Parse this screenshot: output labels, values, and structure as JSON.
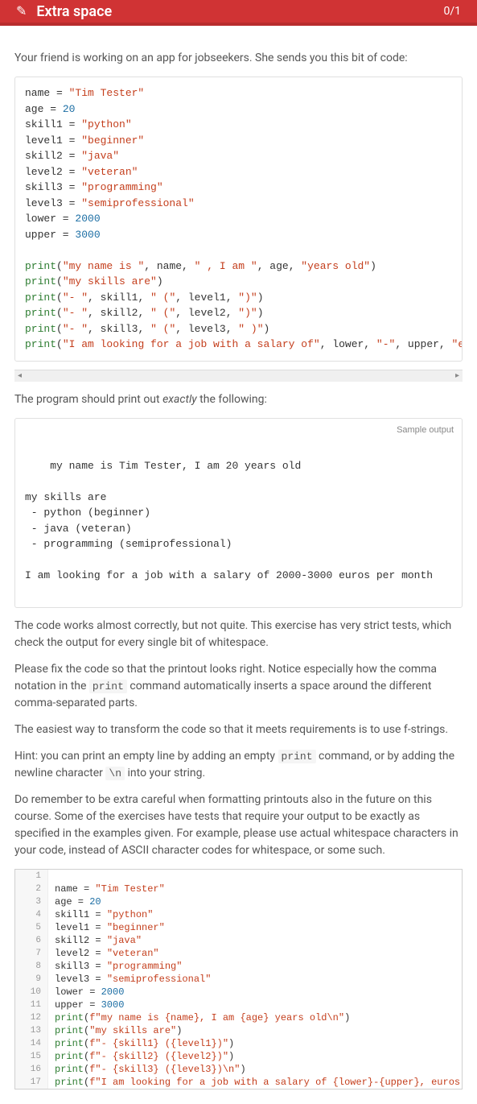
{
  "header": {
    "title": "Extra space",
    "score": "0/1"
  },
  "intro": "Your friend is working on an app for jobseekers. She sends you this bit of code:",
  "code1": [
    [
      [
        "kw",
        "name = "
      ],
      [
        "str",
        "\"Tim Tester\""
      ]
    ],
    [
      [
        "kw",
        "age = "
      ],
      [
        "num",
        "20"
      ]
    ],
    [
      [
        "kw",
        "skill1 = "
      ],
      [
        "str",
        "\"python\""
      ]
    ],
    [
      [
        "kw",
        "level1 = "
      ],
      [
        "str",
        "\"beginner\""
      ]
    ],
    [
      [
        "kw",
        "skill2 = "
      ],
      [
        "str",
        "\"java\""
      ]
    ],
    [
      [
        "kw",
        "level2 = "
      ],
      [
        "str",
        "\"veteran\""
      ]
    ],
    [
      [
        "kw",
        "skill3 = "
      ],
      [
        "str",
        "\"programming\""
      ]
    ],
    [
      [
        "kw",
        "level3 = "
      ],
      [
        "str",
        "\"semiprofessional\""
      ]
    ],
    [
      [
        "kw",
        "lower = "
      ],
      [
        "num",
        "2000"
      ]
    ],
    [
      [
        "kw",
        "upper = "
      ],
      [
        "num",
        "3000"
      ]
    ],
    [
      [
        "kw",
        ""
      ]
    ],
    [
      [
        "fn",
        "print"
      ],
      [
        "kw",
        "("
      ],
      [
        "str",
        "\"my name is \""
      ],
      [
        "kw",
        ", name, "
      ],
      [
        "str",
        "\" , I am \""
      ],
      [
        "kw",
        ", age, "
      ],
      [
        "str",
        "\"years old\""
      ],
      [
        "kw",
        ")"
      ]
    ],
    [
      [
        "fn",
        "print"
      ],
      [
        "kw",
        "("
      ],
      [
        "str",
        "\"my skills are\""
      ],
      [
        "kw",
        ")"
      ]
    ],
    [
      [
        "fn",
        "print"
      ],
      [
        "kw",
        "("
      ],
      [
        "str",
        "\"- \""
      ],
      [
        "kw",
        ", skill1, "
      ],
      [
        "str",
        "\" (\""
      ],
      [
        "kw",
        ", level1, "
      ],
      [
        "str",
        "\")\""
      ],
      [
        "kw",
        ")"
      ]
    ],
    [
      [
        "fn",
        "print"
      ],
      [
        "kw",
        "("
      ],
      [
        "str",
        "\"- \""
      ],
      [
        "kw",
        ", skill2, "
      ],
      [
        "str",
        "\" (\""
      ],
      [
        "kw",
        ", level2, "
      ],
      [
        "str",
        "\")\""
      ],
      [
        "kw",
        ")"
      ]
    ],
    [
      [
        "fn",
        "print"
      ],
      [
        "kw",
        "("
      ],
      [
        "str",
        "\"- \""
      ],
      [
        "kw",
        ", skill3, "
      ],
      [
        "str",
        "\" (\""
      ],
      [
        "kw",
        ", level3, "
      ],
      [
        "str",
        "\" )\""
      ],
      [
        "kw",
        ")"
      ]
    ],
    [
      [
        "fn",
        "print"
      ],
      [
        "kw",
        "("
      ],
      [
        "str",
        "\"I am looking for a job with a salary of\""
      ],
      [
        "kw",
        ", lower, "
      ],
      [
        "str",
        "\"-\""
      ],
      [
        "kw",
        ", upper, "
      ],
      [
        "str",
        "\"euros per mo"
      ]
    ]
  ],
  "p_exact": "The program should print out <em>exactly</em> the following:",
  "sample_label": "Sample output",
  "sample": "my name is Tim Tester, I am 20 years old\n\nmy skills are\n - python (beginner)\n - java (veteran)\n - programming (semiprofessional)\n\nI am looking for a job with a salary of 2000-3000 euros per month",
  "p_fix1": "The code works almost correctly, but not quite. This exercise has very strict tests, which check the output for every single bit of whitespace.",
  "p_fix2": "Please fix the code so that the printout looks right. Notice especially how the comma notation in the <code>print</code> command automatically inserts a space around the different comma-separated parts.",
  "p_fix3": "The easiest way to transform the code so that it meets requirements is to use f-strings.",
  "p_hint": "Hint: you can print an empty line by adding an empty <code>print</code> command, or by adding the newline character <code>\\n</code> into your string.",
  "p_remember": "Do remember to be extra careful when formatting printouts also in the future on this course. Some of the exercises have tests that require your output to be exactly as specified in the examples given. For example, please use actual whitespace characters in your code, instead of ASCII character codes for whitespace, or some such.",
  "editor": [
    {
      "n": "1",
      "t": [
        [
          "kw",
          ""
        ]
      ]
    },
    {
      "n": "2",
      "t": [
        [
          "kw",
          "name = "
        ],
        [
          "str",
          "\"Tim Tester\""
        ]
      ]
    },
    {
      "n": "3",
      "t": [
        [
          "kw",
          "age = "
        ],
        [
          "num",
          "20"
        ]
      ]
    },
    {
      "n": "4",
      "t": [
        [
          "kw",
          "skill1 = "
        ],
        [
          "str",
          "\"python\""
        ]
      ]
    },
    {
      "n": "5",
      "t": [
        [
          "kw",
          "level1 = "
        ],
        [
          "str",
          "\"beginner\""
        ]
      ]
    },
    {
      "n": "6",
      "t": [
        [
          "kw",
          "skill2 = "
        ],
        [
          "str",
          "\"java\""
        ]
      ]
    },
    {
      "n": "7",
      "t": [
        [
          "kw",
          "level2 = "
        ],
        [
          "str",
          "\"veteran\""
        ]
      ]
    },
    {
      "n": "8",
      "t": [
        [
          "kw",
          "skill3 = "
        ],
        [
          "str",
          "\"programming\""
        ]
      ]
    },
    {
      "n": "9",
      "t": [
        [
          "kw",
          "level3 = "
        ],
        [
          "str",
          "\"semiprofessional\""
        ]
      ]
    },
    {
      "n": "10",
      "t": [
        [
          "kw",
          "lower = "
        ],
        [
          "num",
          "2000"
        ]
      ]
    },
    {
      "n": "11",
      "t": [
        [
          "kw",
          "upper = "
        ],
        [
          "num",
          "3000"
        ]
      ]
    },
    {
      "n": "12",
      "t": [
        [
          "fn",
          "print"
        ],
        [
          "kw",
          "("
        ],
        [
          "str",
          "f\"my name is {name}, I am {age} years old\\n\""
        ],
        [
          "kw",
          ")"
        ]
      ]
    },
    {
      "n": "13",
      "t": [
        [
          "fn",
          "print"
        ],
        [
          "kw",
          "("
        ],
        [
          "str",
          "\"my skills are\""
        ],
        [
          "kw",
          ")"
        ]
      ]
    },
    {
      "n": "14",
      "t": [
        [
          "fn",
          "print"
        ],
        [
          "kw",
          "("
        ],
        [
          "str",
          "f\"- {skill1} ({level1})\""
        ],
        [
          "kw",
          ")"
        ]
      ]
    },
    {
      "n": "15",
      "t": [
        [
          "fn",
          "print"
        ],
        [
          "kw",
          "("
        ],
        [
          "str",
          "f\"- {skill2} ({level2})\""
        ],
        [
          "kw",
          ")"
        ]
      ]
    },
    {
      "n": "16",
      "t": [
        [
          "fn",
          "print"
        ],
        [
          "kw",
          "("
        ],
        [
          "str",
          "f\"- {skill3} ({level3})\\n\""
        ],
        [
          "kw",
          ")"
        ]
      ]
    },
    {
      "n": "17",
      "t": [
        [
          "fn",
          "print"
        ],
        [
          "kw",
          "("
        ],
        [
          "str",
          "f\"I am looking for a job with a salary of {lower}-{upper}, euros per month\""
        ],
        [
          "kw",
          ")"
        ]
      ]
    }
  ]
}
